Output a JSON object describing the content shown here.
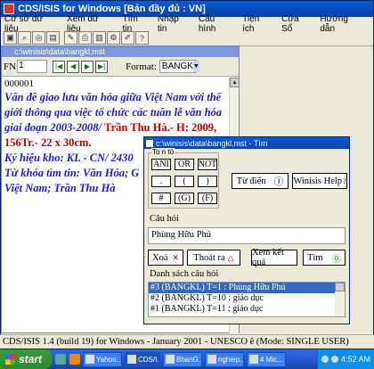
{
  "app": {
    "title": "CDS/ISIS for Windows [Bản đầy đủ : VN]",
    "menu": [
      "Cơ sở dữ liệu",
      "Xem dữ liệu",
      "Tìm tin",
      "Nhập tin",
      "Cấu hình",
      "Tiện ích",
      "Cửa Sổ",
      "Hướng dẫn"
    ]
  },
  "doc": {
    "title": "c:\\winisis\\data\\bangkl.mst",
    "fn_label": "FN",
    "fn_value": "1",
    "format_label": "Format:",
    "format_value": "BANGK",
    "record_number": "000001",
    "record_lines": {
      "title_part": "Vấn đề giao lưu văn hóa giữa Việt Nam với thế giới thông qua việc tổ chức các tuần lễ văn hóa giai đoạn 2003-2008/",
      "author_part": "Trần Thu Hà.- H: 2009, 156Tr.- 22 x 30cm.",
      "callno_part": "Ký hiệu kho:  KL - CN/ 2430",
      "keywords_part": "Từ khóa tìm tin:  Văn Hóa; G",
      "keywords_part2": "Việt Nam; Trần Thu Hà"
    }
  },
  "search": {
    "title": "c:\\winisis\\data\\bangkl.mst - Tìm",
    "ops_caption": "To n tö",
    "ops": [
      "ANI",
      "OR",
      "NOT",
      ".",
      "(",
      ")",
      "#",
      "(G)",
      "(F)"
    ],
    "dictionary_label": "Từ điển",
    "help_label": "Winisis Help",
    "query_label": "Câu hỏi",
    "query_value": "Phùng Hữu Phú",
    "clear_label": "Xoá",
    "exit_label": "Thoát ra",
    "results_label": "Xem kết quả",
    "find_label": "Tìm",
    "history_label": "Danh sách câu hỏi",
    "history": [
      "#3 (BANGKL) T=1 : Phùng Hữu Phú",
      "#2 (BANGKL) T=10 : giáo dục",
      "#1 (BANGKL) T=11 : giáo dục"
    ]
  },
  "status": "CDS/ISIS 1.4 (build 19) for Windows - January 2001 - UNESCO ê (Mode: SINGLE USER)",
  "taskbar": {
    "start": "start",
    "tasks": [
      "Yahoo...",
      "CDS/I...",
      "BhanG...",
      "nghiep...",
      "4 Mic..."
    ],
    "clock": "4:52 AM"
  }
}
